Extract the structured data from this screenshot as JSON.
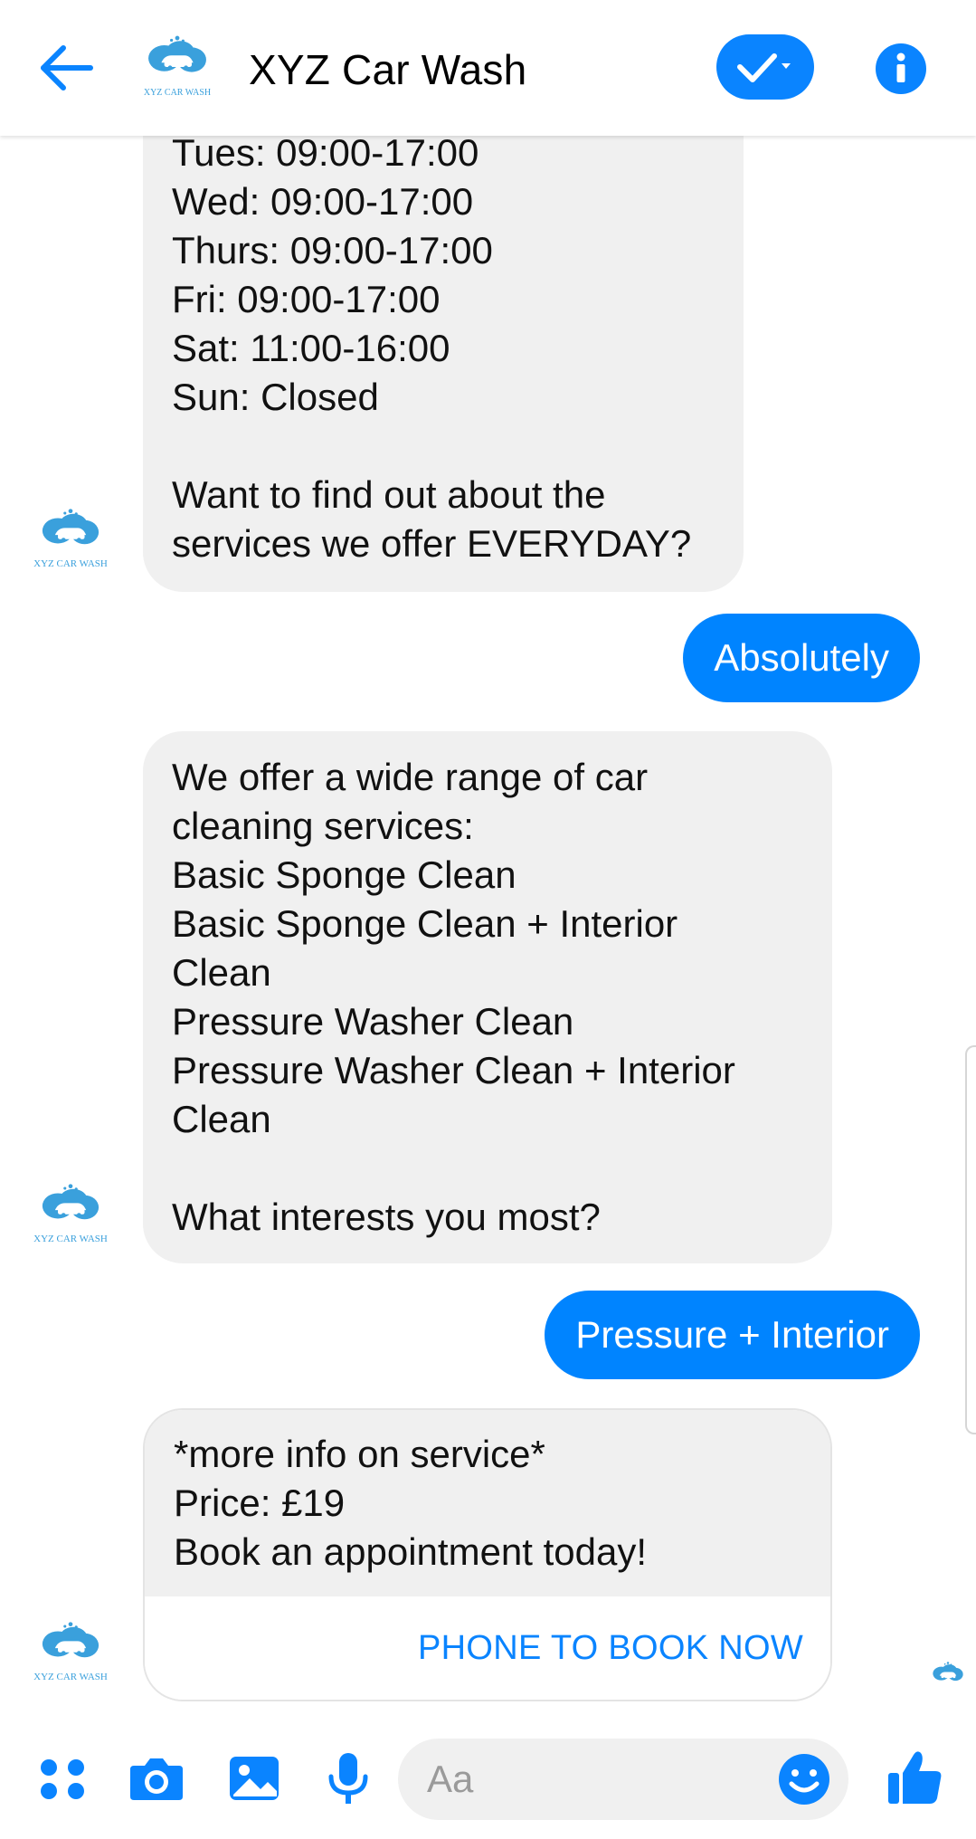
{
  "header": {
    "title": "XYZ Car Wash",
    "logo_text": "XYZ CAR WASH"
  },
  "messages": {
    "hours_text": "Tues: 09:00-17:00\nWed: 09:00-17:00\nThurs: 09:00-17:00\nFri: 09:00-17:00\nSat: 11:00-16:00\nSun: Closed\n\nWant to find out about the\nservices we offer EVERYDAY?",
    "reply_1": "Absolutely",
    "services_text": "We offer a wide range of car\ncleaning services:\nBasic Sponge Clean\nBasic Sponge Clean + Interior\nClean\nPressure Washer Clean\nPressure Washer Clean + Interior\nClean\n\nWhat interests you most?",
    "reply_2": "Pressure + Interior",
    "card_text": "*more info on service*\nPrice: £19\nBook an appointment today!",
    "card_button": "PHONE TO BOOK NOW"
  },
  "composer": {
    "placeholder": "Aa"
  },
  "colors": {
    "accent": "#0084ff",
    "incoming_bubble": "#f0f0f0",
    "logo": "#3aa0dc"
  }
}
